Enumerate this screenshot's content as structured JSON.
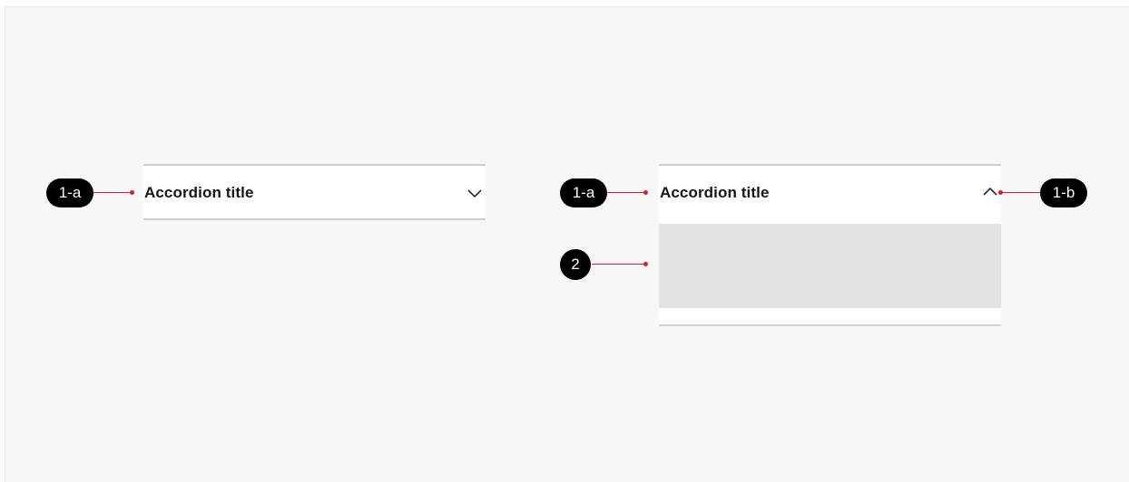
{
  "accordion_closed": {
    "title": "Accordion title",
    "state": "collapsed",
    "icon": "chevron-down-icon"
  },
  "accordion_open": {
    "title": "Accordion title",
    "state": "expanded",
    "icon": "chevron-up-icon"
  },
  "callouts": {
    "left_title": "1-a",
    "right_title": "1-a",
    "right_icon": "1-b",
    "content": "2"
  },
  "colors": {
    "background": "#f7f7f7",
    "accordion_bg": "#ffffff",
    "divider": "#d0d0d0",
    "content_placeholder": "#e3e3e3",
    "callout_bg": "#000000",
    "leader_line": "#da1e28",
    "title_text": "#161616"
  }
}
